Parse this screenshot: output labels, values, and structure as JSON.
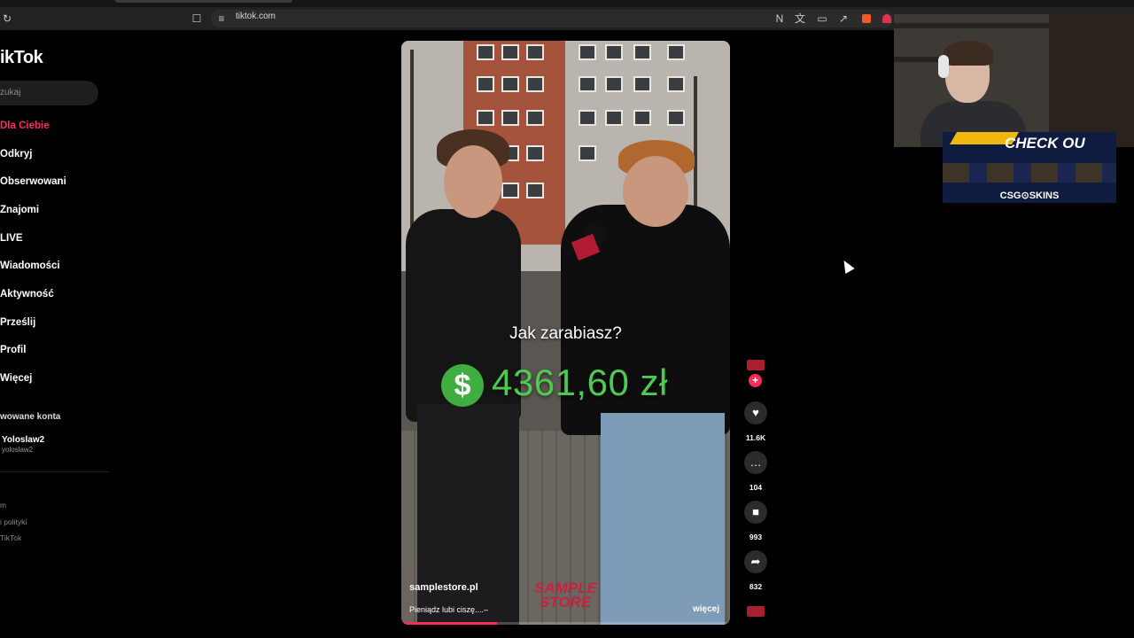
{
  "browser": {
    "url": "tiktok.com",
    "icons": [
      "reload-icon",
      "bookmark-icon",
      "site-info-icon",
      "translate-off-icon",
      "translate-icon",
      "cast-icon",
      "share-icon",
      "brave-shield-icon",
      "brave-rewards-icon"
    ]
  },
  "sidebar": {
    "logo": "ikTok",
    "search_placeholder": "zukaj",
    "nav": [
      {
        "label": "Dla Ciebie",
        "active": true
      },
      {
        "label": "Odkryj"
      },
      {
        "label": "Obserwowani"
      },
      {
        "label": "Znajomi"
      },
      {
        "label": "LIVE"
      },
      {
        "label": "Wiadomości"
      },
      {
        "label": "Aktywność"
      },
      {
        "label": "Prześlij"
      },
      {
        "label": "Profil"
      },
      {
        "label": "Więcej"
      }
    ],
    "followed_title": "wowane konta",
    "account": {
      "name": "Yoloslaw2",
      "handle": "yoloslaw2"
    },
    "footer": [
      "m",
      "i polityki",
      "TikTok"
    ]
  },
  "video": {
    "question": "Jak zarabiasz?",
    "money_symbol": "$",
    "amount": "4361,60 zł",
    "store_url": "samplestore.pl",
    "caption": "Pieniądz lubi ciszę....–",
    "more_label": "więcej",
    "watermark": "SAMPLE STORE",
    "progress": 0.29
  },
  "actions": {
    "follow_symbol": "+",
    "likes": "11.6K",
    "comments": "104",
    "saves": "993",
    "shares": "832"
  },
  "overlay": {
    "ad_headline": "CHECK OU",
    "ad_brand": "CSG⊙SKINS"
  },
  "colors": {
    "accent": "#fe2c55",
    "money": "#4fc94f",
    "background": "#000000"
  }
}
